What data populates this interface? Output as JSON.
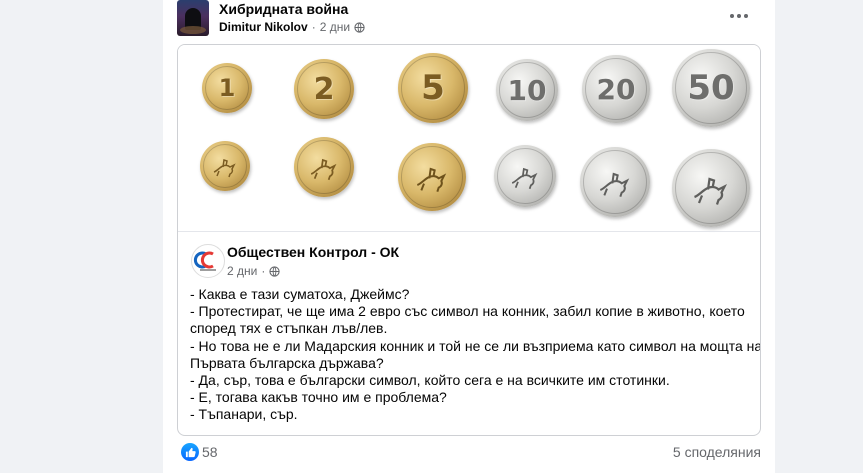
{
  "post": {
    "group_name": "Хибридната война",
    "author": "Dimitur Nikolov",
    "separator": "·",
    "time": "2 дни"
  },
  "coins": {
    "row1": [
      {
        "label": "1",
        "metal": "gold"
      },
      {
        "label": "2",
        "metal": "gold"
      },
      {
        "label": "5",
        "metal": "gold"
      },
      {
        "label": "10",
        "metal": "silver"
      },
      {
        "label": "20",
        "metal": "silver"
      },
      {
        "label": "50",
        "metal": "silver"
      }
    ]
  },
  "shared_post": {
    "page_name": "Обществен Контрол - ОК",
    "time": "2 дни",
    "separator": "·",
    "lines": [
      "- Каква е тази суматоха, Джеймс?",
      "- Протестират, че ще има 2 евро със символ на конник, забил копие в животно, което",
      "според тях е стъпкан лъв/лев.",
      "- Но това не е ли Мадарския конник и той не се ли възприема като символ на мощта на",
      "Първата българска държава?",
      "- Да, сър, това е български символ, който сега е на всичките им стотинки.",
      "- Е, тогава какъв точно им е проблема?",
      "- Тъпанари, сър."
    ]
  },
  "footer": {
    "reactions_count": "58",
    "shares": "5 споделяния"
  },
  "colors": {
    "background": "#f0f2f5",
    "card": "#ffffff",
    "secondary_text": "#65676b",
    "like_blue": "#0866ff",
    "gold_coin": "#d9b86a",
    "silver_coin": "#c8c8c6"
  }
}
